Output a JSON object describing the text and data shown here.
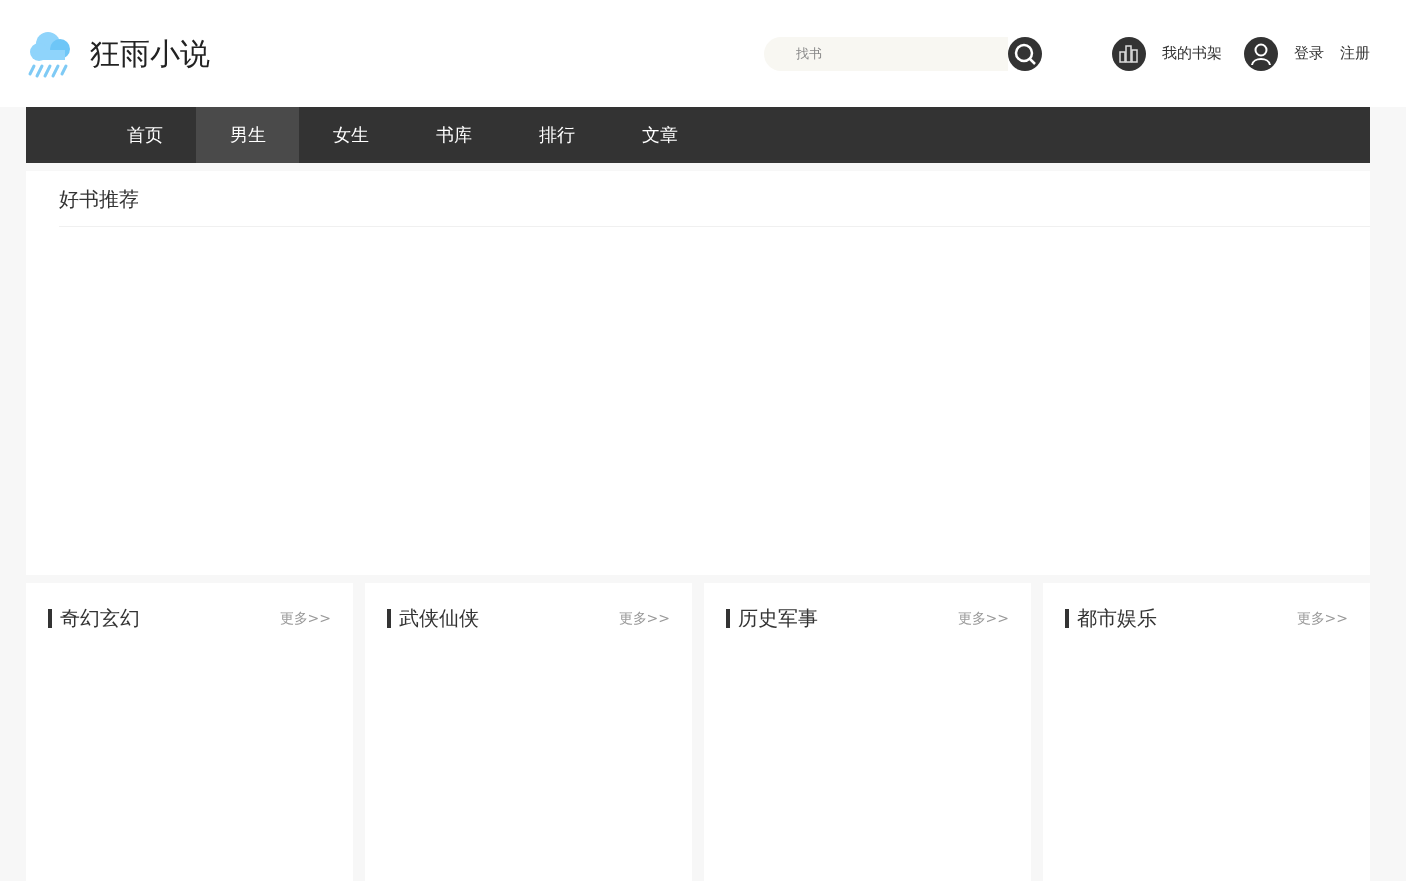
{
  "logo": {
    "text": "狂雨小说"
  },
  "search": {
    "placeholder": "找书"
  },
  "user_links": {
    "bookshelf": "我的书架",
    "login": "登录",
    "register": "注册"
  },
  "nav": [
    {
      "label": "首页",
      "selected": false
    },
    {
      "label": "男生",
      "selected": true
    },
    {
      "label": "女生",
      "selected": false
    },
    {
      "label": "书库",
      "selected": false
    },
    {
      "label": "排行",
      "selected": false
    },
    {
      "label": "文章",
      "selected": false
    }
  ],
  "recommend": {
    "title": "好书推荐"
  },
  "categories": [
    {
      "title": "奇幻玄幻",
      "more": "更多>>"
    },
    {
      "title": "武侠仙侠",
      "more": "更多>>"
    },
    {
      "title": "历史军事",
      "more": "更多>>"
    },
    {
      "title": "都市娱乐",
      "more": "更多>>"
    }
  ]
}
